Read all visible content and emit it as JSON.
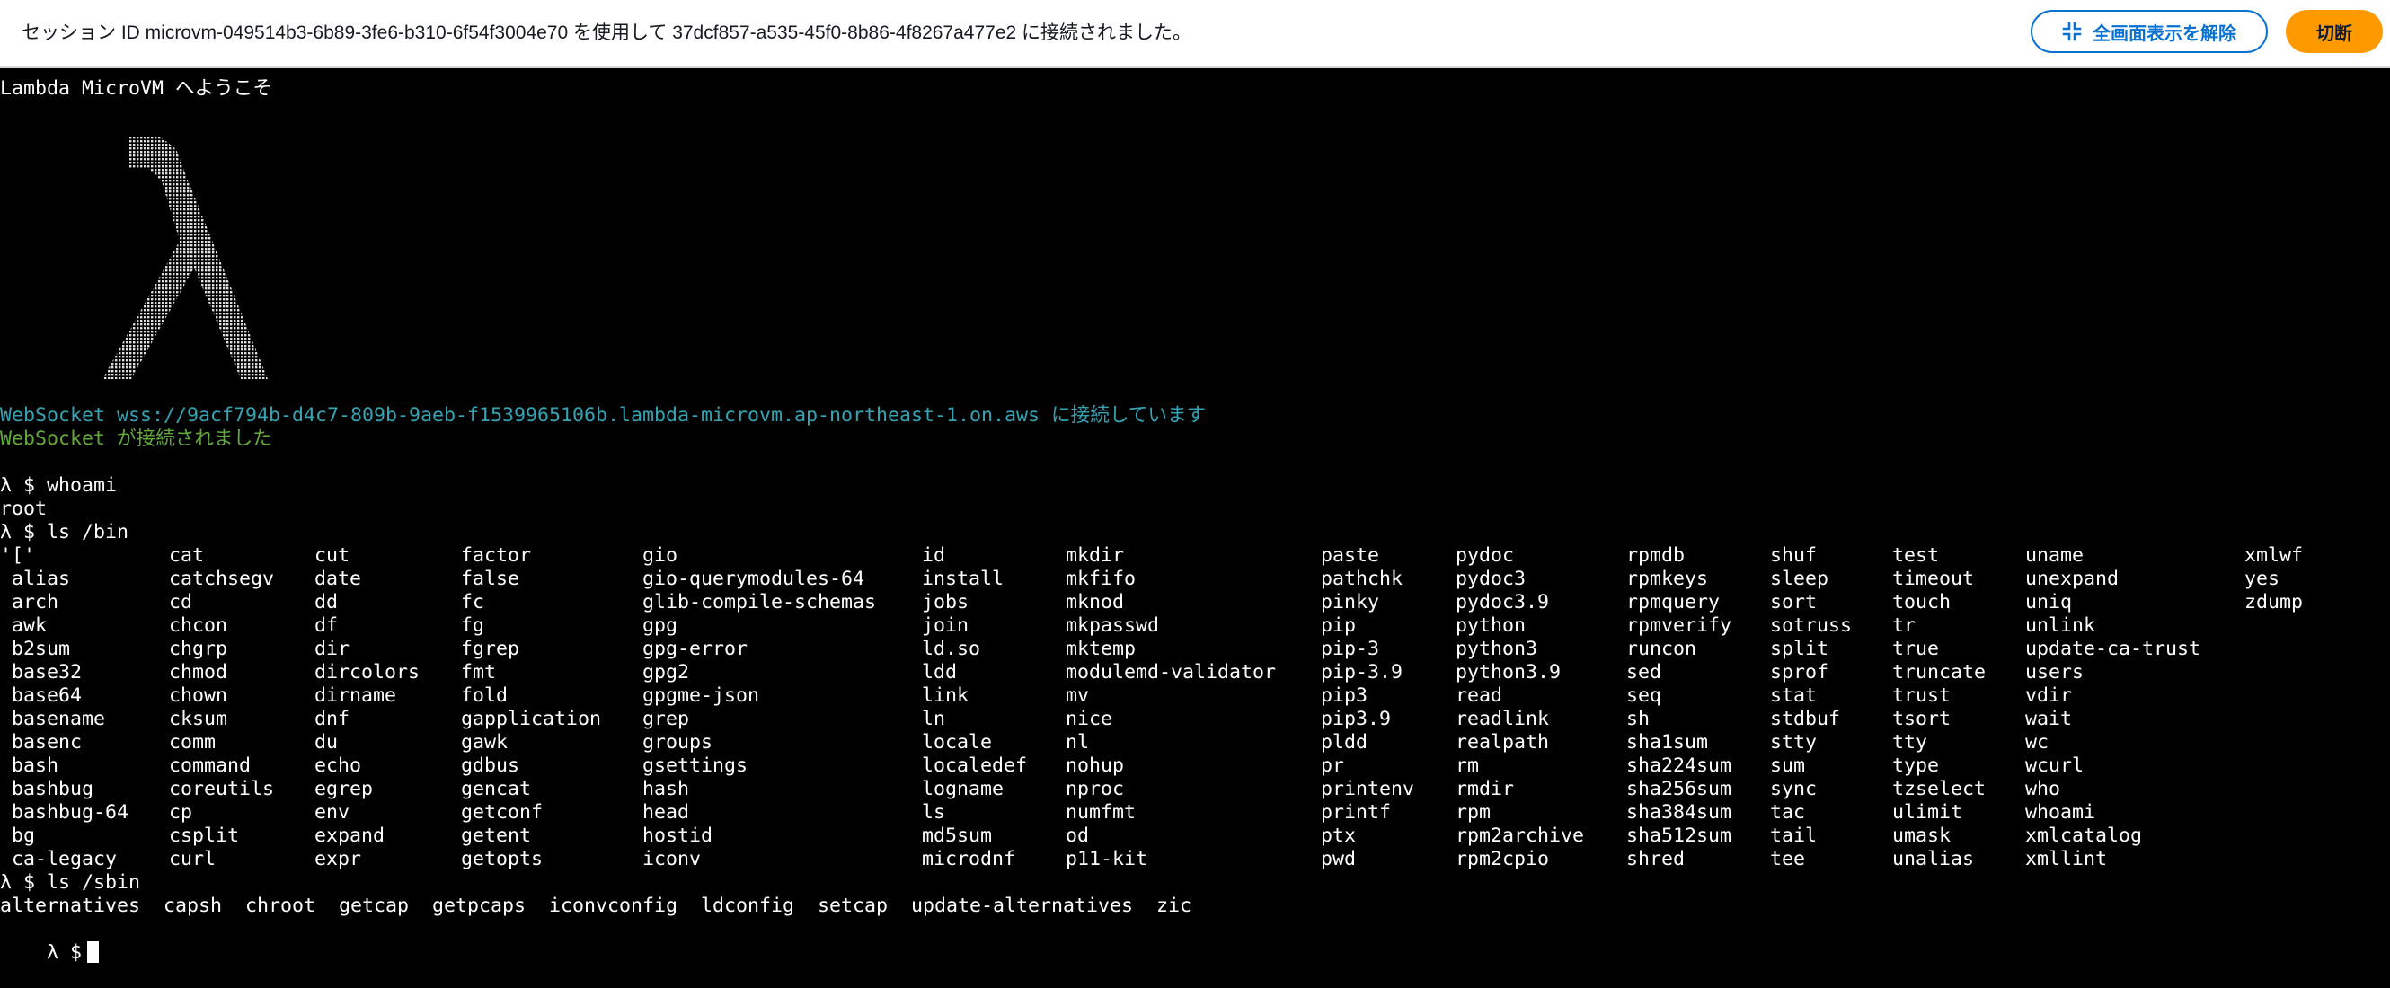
{
  "header": {
    "session_message": "セッション ID microvm-049514b3-6b89-3fe6-b310-6f54f3004e70 を使用して 37dcf857-a535-45f0-8b86-4f8267a477e2 に接続されました。",
    "exit_fullscreen_label": "全画面表示を解除",
    "disconnect_label": "切断"
  },
  "terminal": {
    "welcome": "Lambda MicroVM へようこそ",
    "ws_connecting": "WebSocket wss://9acf794b-d4c7-809b-9aeb-f1539965106b.lambda-microvm.ap-northeast-1.on.aws に接続しています",
    "ws_connected": "WebSocket が接続されました",
    "prompt": "λ $",
    "cmd_whoami": "λ $ whoami",
    "whoami_output": "root",
    "cmd_ls_bin": "λ $ ls /bin",
    "bin_columns": [
      [
        "'['",
        " alias",
        " arch",
        " awk",
        " b2sum",
        " base32",
        " base64",
        " basename",
        " basenc",
        " bash",
        " bashbug",
        " bashbug-64",
        " bg",
        " ca-legacy"
      ],
      [
        "cat",
        "catchsegv",
        "cd",
        "chcon",
        "chgrp",
        "chmod",
        "chown",
        "cksum",
        "comm",
        "command",
        "coreutils",
        "cp",
        "csplit",
        "curl"
      ],
      [
        "cut",
        "date",
        "dd",
        "df",
        "dir",
        "dircolors",
        "dirname",
        "dnf",
        "du",
        "echo",
        "egrep",
        "env",
        "expand",
        "expr"
      ],
      [
        "factor",
        "false",
        "fc",
        "fg",
        "fgrep",
        "fmt",
        "fold",
        "gapplication",
        "gawk",
        "gdbus",
        "gencat",
        "getconf",
        "getent",
        "getopts"
      ],
      [
        "gio",
        "gio-querymodules-64",
        "glib-compile-schemas",
        "gpg",
        "gpg-error",
        "gpg2",
        "gpgme-json",
        "grep",
        "groups",
        "gsettings",
        "hash",
        "head",
        "hostid",
        "iconv"
      ],
      [
        "id",
        "install",
        "jobs",
        "join",
        "ld.so",
        "ldd",
        "link",
        "ln",
        "locale",
        "localedef",
        "logname",
        "ls",
        "md5sum",
        "microdnf"
      ],
      [
        "mkdir",
        "mkfifo",
        "mknod",
        "mkpasswd",
        "mktemp",
        "modulemd-validator",
        "mv",
        "nice",
        "nl",
        "nohup",
        "nproc",
        "numfmt",
        "od",
        "p11-kit"
      ],
      [
        "paste",
        "pathchk",
        "pinky",
        "pip",
        "pip-3",
        "pip-3.9",
        "pip3",
        "pip3.9",
        "pldd",
        "pr",
        "printenv",
        "printf",
        "ptx",
        "pwd"
      ],
      [
        "pydoc",
        "pydoc3",
        "pydoc3.9",
        "python",
        "python3",
        "python3.9",
        "read",
        "readlink",
        "realpath",
        "rm",
        "rmdir",
        "rpm",
        "rpm2archive",
        "rpm2cpio"
      ],
      [
        "rpmdb",
        "rpmkeys",
        "rpmquery",
        "rpmverify",
        "runcon",
        "sed",
        "seq",
        "sh",
        "sha1sum",
        "sha224sum",
        "sha256sum",
        "sha384sum",
        "sha512sum",
        "shred"
      ],
      [
        "shuf",
        "sleep",
        "sort",
        "sotruss",
        "split",
        "sprof",
        "stat",
        "stdbuf",
        "stty",
        "sum",
        "sync",
        "tac",
        "tail",
        "tee"
      ],
      [
        "test",
        "timeout",
        "touch",
        "tr",
        "true",
        "truncate",
        "trust",
        "tsort",
        "tty",
        "type",
        "tzselect",
        "ulimit",
        "umask",
        "unalias"
      ],
      [
        "uname",
        "unexpand",
        "uniq",
        "unlink",
        "update-ca-trust",
        "users",
        "vdir",
        "wait",
        "wc",
        "wcurl",
        "who",
        "whoami",
        "xmlcatalog",
        "xmllint"
      ],
      [
        "xmlwf",
        "yes",
        "zdump"
      ]
    ],
    "cmd_ls_sbin": "λ $ ls /sbin",
    "sbin_output": "alternatives  capsh  chroot  getcap  getpcaps  iconvconfig  ldconfig  setcap  update-alternatives  zic"
  }
}
